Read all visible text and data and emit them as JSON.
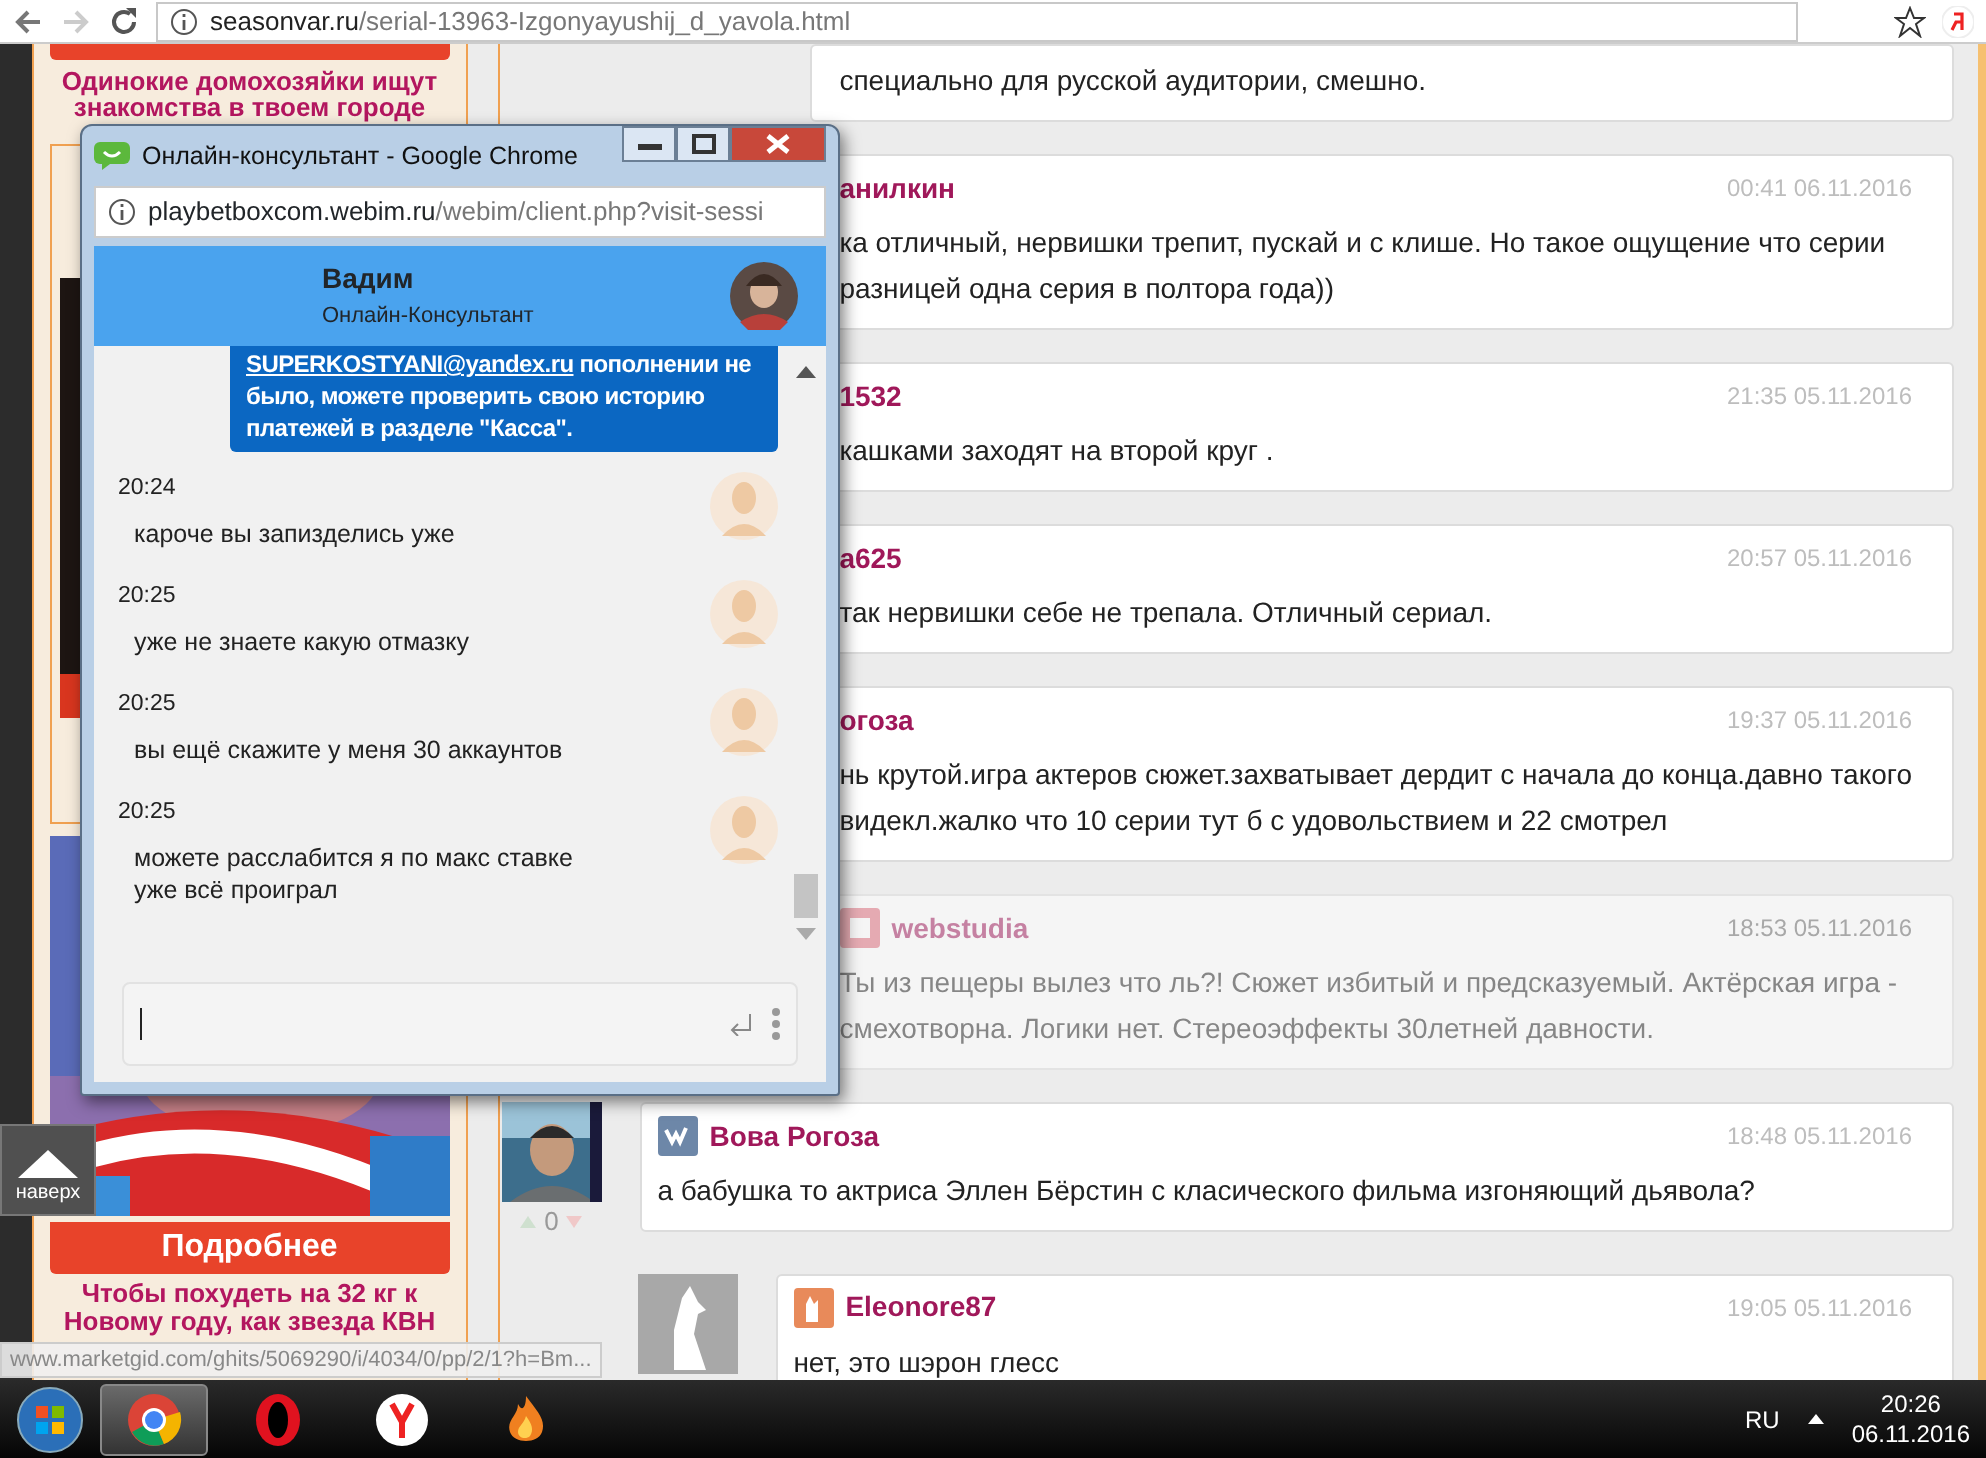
{
  "browser": {
    "address": {
      "domain": "seasonvar.ru",
      "path": "/serial-13963-Izgonyayushij_d_yavola.html"
    }
  },
  "sidebar": {
    "top_ad": {
      "title": "Одинокие домохозяйки ищут знакомства в твоем городе"
    },
    "bottom_ad": {
      "button": "Подробнее",
      "title": "Чтобы похудеть на 32 кг к Новому году, как звезда КВН"
    },
    "scroll_top_button": "наверх",
    "status_url": "www.marketgid.com/ghits/5069290/i/4034/0/pp/2/1?h=Bm..."
  },
  "comments": [
    {
      "kind": "reply",
      "faded": false,
      "lines": [
        "специально для русской аудитории, смешно."
      ]
    },
    {
      "kind": "reply",
      "faded": false,
      "author": "анилкин",
      "time": "00:41 06.11.2016",
      "lines": [
        "ка отличный, нервишки трепит, пускай и с клише. Но такое ощущение что серии",
        "разницей одна серия в полтора года))"
      ]
    },
    {
      "kind": "reply",
      "faded": false,
      "author": "1532",
      "time": "21:35 05.11.2016",
      "lines": [
        "кашками заходят на второй круг ."
      ]
    },
    {
      "kind": "reply",
      "faded": false,
      "author": "а625",
      "time": "20:57 05.11.2016",
      "lines": [
        "так нервишки себе не трепала. Отличный сериал."
      ]
    },
    {
      "kind": "reply",
      "faded": false,
      "author": "огоза",
      "time": "19:37 05.11.2016",
      "lines": [
        "нь крутой.игра актеров сюжет.захватывает дердит с начала до конца.давно такого",
        "видекл.жалко что 10 серии тут б с удовольствием и 22 смотрел"
      ]
    },
    {
      "kind": "site",
      "faded": true,
      "author": "webstudia",
      "time": "18:53 05.11.2016",
      "lines": [
        "Ты из пещеры вылез что ль?! Сюжет избитый и предсказуемый. Актёрская игра -",
        "смехотворна. Логики нет. Стереоэффекты 30летней давности."
      ]
    },
    {
      "kind": "vk",
      "faded": false,
      "votes": "0",
      "author": "Вова Рогоза",
      "time": "18:48 05.11.2016",
      "lines": [
        "а бабушка то актриса Эллен Бёрстин с класического фильма изгоняющий дьявола?"
      ],
      "children": [
        {
          "kind": "cat",
          "faded": false,
          "author": "Eleonore87",
          "time": "19:05 05.11.2016",
          "lines": [
            "нет, это шэрон глесс"
          ]
        }
      ]
    }
  ],
  "popup": {
    "title": "Онлайн-консультант - Google Chrome",
    "address": {
      "domain": "playbetboxcom.webim.ru",
      "path": "/webim/client.php?visit-sessi"
    },
    "operator": {
      "name": "Вадим",
      "role": "Онлайн-Консультант"
    },
    "operator_message": {
      "link": "SUPERKOSTYANI@yandex.ru",
      "text": " пополнении не было, можете проверить свою историю платежей в разделе \"Касса\"."
    },
    "messages": [
      {
        "time": "20:24",
        "text": "кароче вы запизделись уже"
      },
      {
        "time": "20:25",
        "text": "уже не знаете какую отмазку"
      },
      {
        "time": "20:25",
        "text": "вы ещё скажите у меня 30 аккаунтов"
      },
      {
        "time": "20:25",
        "text": "можете расслабится я по макс ставке уже всё проиграл"
      }
    ]
  },
  "taskbar": {
    "apps": [
      {
        "kind": "chrome",
        "selected": true
      },
      {
        "kind": "opera",
        "selected": false
      },
      {
        "kind": "yandex",
        "selected": false
      },
      {
        "kind": "flame",
        "selected": false
      }
    ],
    "language": "RU",
    "time": "20:26",
    "date": "06.11.2016"
  }
}
